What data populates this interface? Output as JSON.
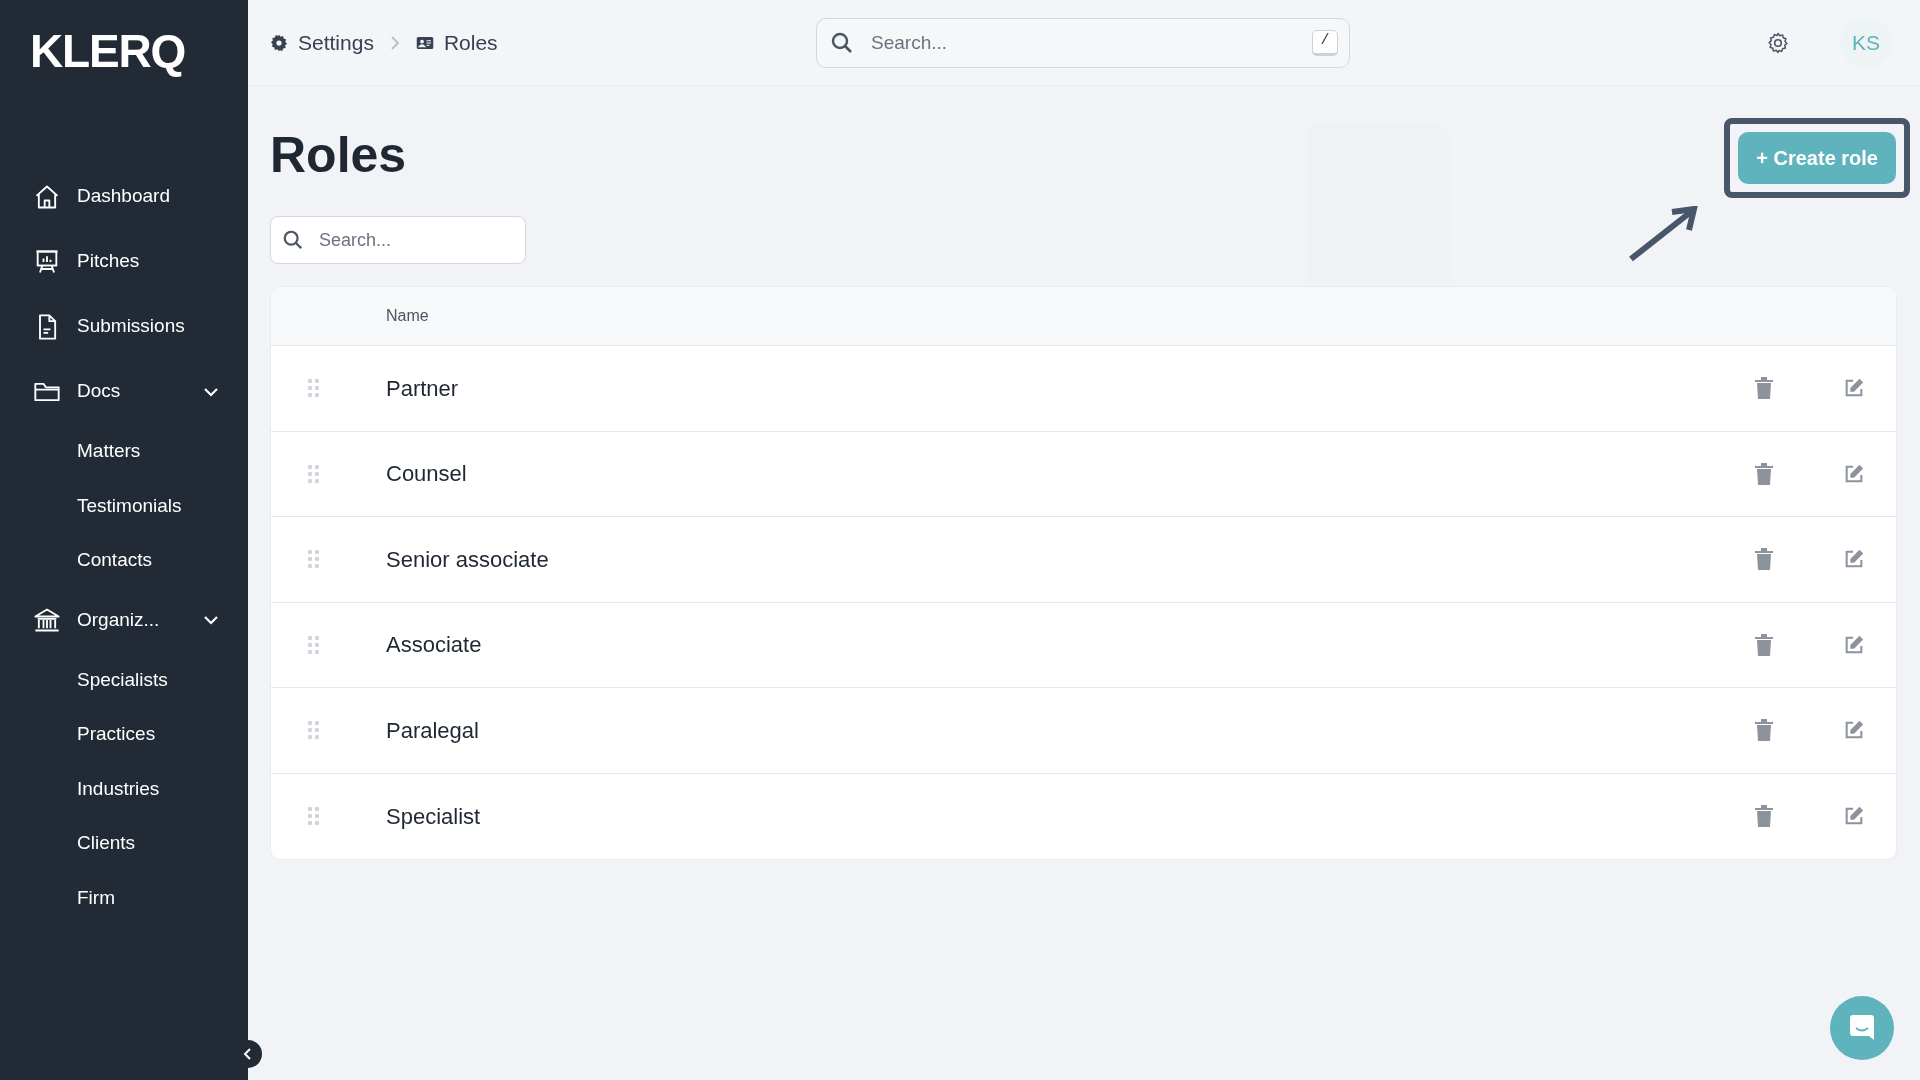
{
  "sidebar": {
    "logo": "KLERQ",
    "items": [
      {
        "label": "Dashboard"
      },
      {
        "label": "Pitches"
      },
      {
        "label": "Submissions"
      },
      {
        "label": "Docs",
        "expanded": true,
        "children": [
          {
            "label": "Matters"
          },
          {
            "label": "Testimonials"
          },
          {
            "label": "Contacts"
          }
        ]
      },
      {
        "label": "Organiz...",
        "expanded": true,
        "children": [
          {
            "label": "Specialists"
          },
          {
            "label": "Practices"
          },
          {
            "label": "Industries"
          },
          {
            "label": "Clients"
          },
          {
            "label": "Firm"
          }
        ]
      }
    ]
  },
  "breadcrumb": [
    "Settings",
    "Roles"
  ],
  "top_search": {
    "placeholder": "Search...",
    "shortcut": "/"
  },
  "avatar": "KS",
  "page": {
    "title": "Roles",
    "search": {
      "placeholder": "Search..."
    },
    "create_button": "+ Create role"
  },
  "table": {
    "columns": [
      "Name"
    ],
    "rows": [
      {
        "name": "Partner"
      },
      {
        "name": "Counsel"
      },
      {
        "name": "Senior associate"
      },
      {
        "name": "Associate"
      },
      {
        "name": "Paralegal"
      },
      {
        "name": "Specialist"
      }
    ]
  }
}
